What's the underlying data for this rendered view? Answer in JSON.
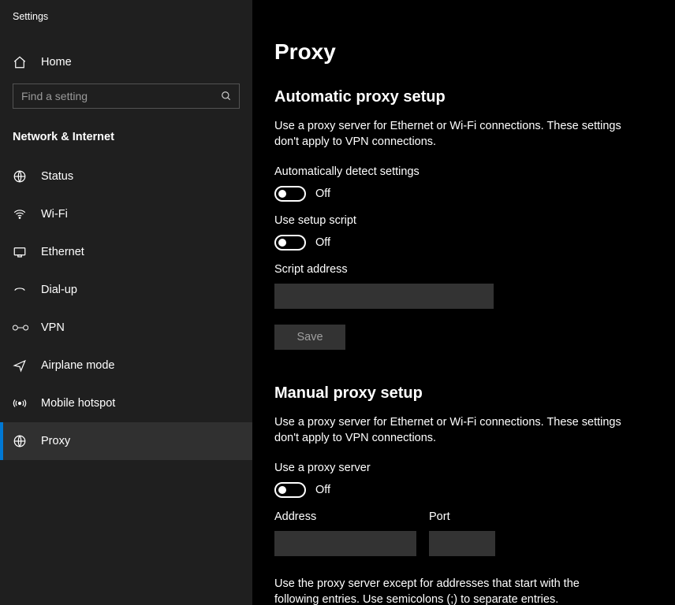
{
  "appTitle": "Settings",
  "home": {
    "label": "Home"
  },
  "search": {
    "placeholder": "Find a setting"
  },
  "categoryTitle": "Network & Internet",
  "nav": [
    {
      "key": "status",
      "label": "Status"
    },
    {
      "key": "wifi",
      "label": "Wi-Fi"
    },
    {
      "key": "ethernet",
      "label": "Ethernet"
    },
    {
      "key": "dialup",
      "label": "Dial-up"
    },
    {
      "key": "vpn",
      "label": "VPN"
    },
    {
      "key": "airplane",
      "label": "Airplane mode"
    },
    {
      "key": "hotspot",
      "label": "Mobile hotspot"
    },
    {
      "key": "proxy",
      "label": "Proxy"
    }
  ],
  "page": {
    "title": "Proxy",
    "auto": {
      "heading": "Automatic proxy setup",
      "desc": "Use a proxy server for Ethernet or Wi-Fi connections. These settings don't apply to VPN connections.",
      "autoDetect": {
        "label": "Automatically detect settings",
        "state": "Off"
      },
      "setupScript": {
        "label": "Use setup script",
        "state": "Off"
      },
      "scriptAddress": {
        "label": "Script address",
        "value": ""
      },
      "saveLabel": "Save"
    },
    "manual": {
      "heading": "Manual proxy setup",
      "desc": "Use a proxy server for Ethernet or Wi-Fi connections. These settings don't apply to VPN connections.",
      "useProxy": {
        "label": "Use a proxy server",
        "state": "Off"
      },
      "address": {
        "label": "Address",
        "value": ""
      },
      "port": {
        "label": "Port",
        "value": ""
      },
      "except": "Use the proxy server except for addresses that start with the following entries. Use semicolons (;) to separate entries."
    }
  }
}
